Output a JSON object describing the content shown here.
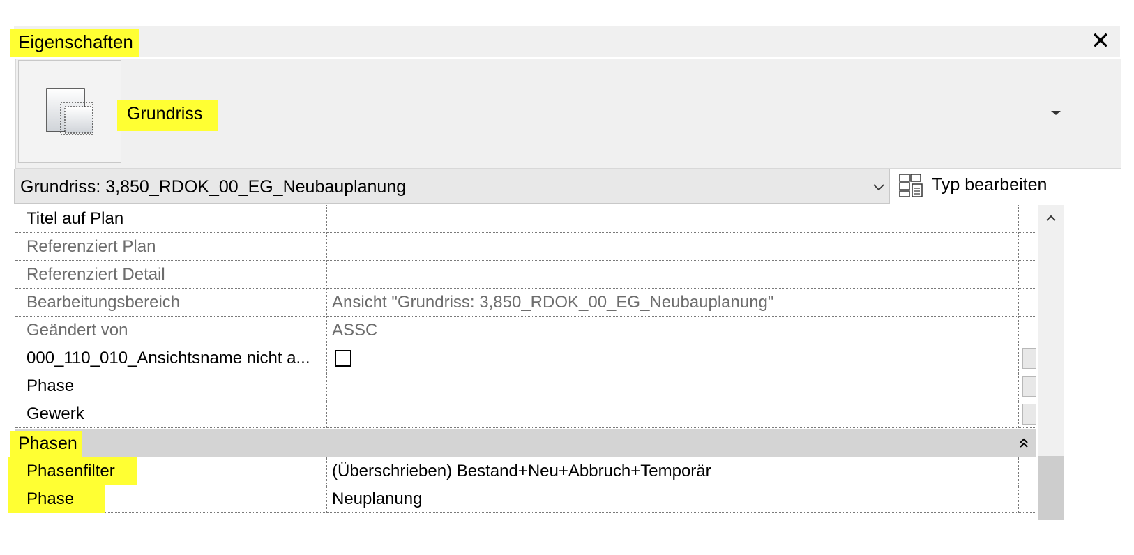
{
  "panel": {
    "title": "Eigenschaften",
    "close_label": "✕"
  },
  "type_selector": {
    "family_name": "Grundriss"
  },
  "instance": {
    "selector_text": "Grundriss: 3,850_RDOK_00_EG_Neubauplanung",
    "edit_type_label": "Typ bearbeiten"
  },
  "properties": {
    "rows": [
      {
        "name": "Titel auf Plan",
        "value": "",
        "disabled": false
      },
      {
        "name": "Referenziert Plan",
        "value": "",
        "disabled": true
      },
      {
        "name": "Referenziert Detail",
        "value": "",
        "disabled": true
      },
      {
        "name": "Bearbeitungsbereich",
        "value": "Ansicht \"Grundriss: 3,850_RDOK_00_EG_Neubauplanung\"",
        "disabled": true
      },
      {
        "name": "Geändert von",
        "value": "ASSC",
        "disabled": true
      },
      {
        "name": "000_110_010_Ansichtsname nicht a...",
        "value": "",
        "checkbox": true,
        "checked": false
      },
      {
        "name": "Phase",
        "value": ""
      },
      {
        "name": "Gewerk",
        "value": ""
      }
    ],
    "group": {
      "title": "Phasen",
      "collapse_glyph": "⌃",
      "rows": [
        {
          "name": "Phasenfilter",
          "value": "(Überschrieben) Bestand+Neu+Abbruch+Temporär"
        },
        {
          "name": "Phase",
          "value": "Neuplanung"
        }
      ]
    }
  },
  "highlight_color": "#ffff33",
  "icons": {
    "close": "close-icon",
    "type_thumbnail": "floor-plan-icon",
    "dropdown": "dropdown-arrow-icon",
    "instance_chevron": "chevron-down-icon",
    "edit_type": "edit-type-icon",
    "scroll_up": "scroll-up-icon",
    "group_collapse": "collapse-icon"
  }
}
